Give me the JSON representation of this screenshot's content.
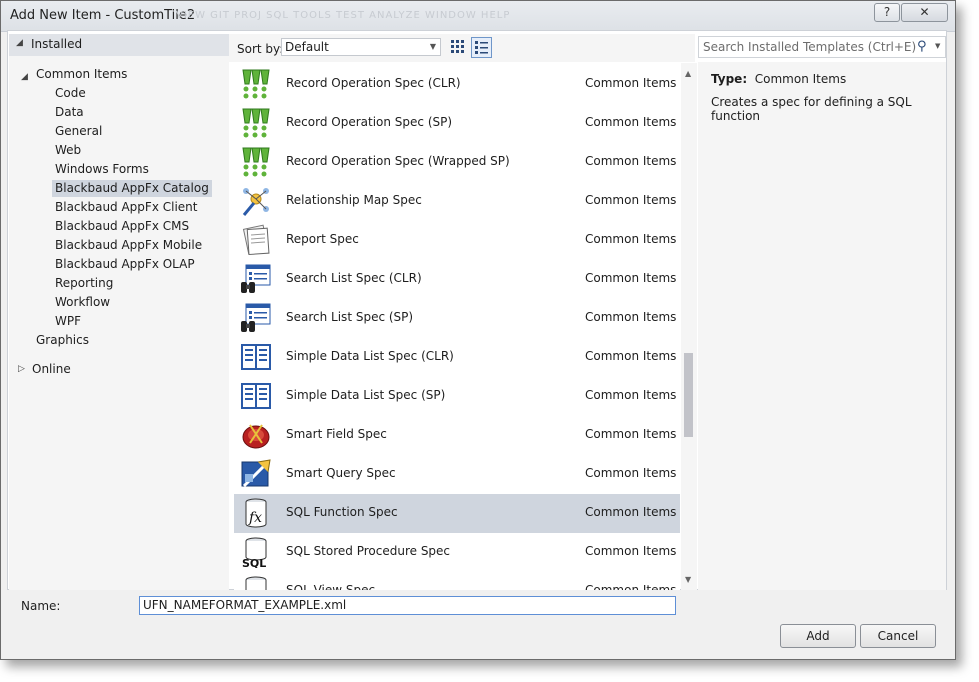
{
  "window": {
    "title": "Add New Item - CustomTile2",
    "ghost_menu": "VIEW   GIT   PROJ   SQL   TOOLS   TEST   ANALYZE   WINDOW   HELP",
    "help_label": "?",
    "close_label": "✕"
  },
  "tree": {
    "installed_label": "Installed",
    "common_items_label": "Common Items",
    "children": [
      "Code",
      "Data",
      "General",
      "Web",
      "Windows Forms",
      "Blackbaud AppFx Catalog",
      "Blackbaud AppFx Client",
      "Blackbaud AppFx CMS",
      "Blackbaud AppFx Mobile",
      "Blackbaud AppFx OLAP",
      "Reporting",
      "Workflow",
      "WPF"
    ],
    "selected_child": "Blackbaud AppFx Catalog",
    "graphics_label": "Graphics",
    "online_label": "Online"
  },
  "sort": {
    "label": "Sort by:",
    "value": "Default"
  },
  "search": {
    "placeholder": "Search Installed Templates (Ctrl+E)"
  },
  "templates": [
    {
      "name": "Record Operation Spec (CLR)",
      "category": "Common Items",
      "icon": "record-operation-icon"
    },
    {
      "name": "Record Operation Spec (SP)",
      "category": "Common Items",
      "icon": "record-operation-icon"
    },
    {
      "name": "Record Operation Spec (Wrapped SP)",
      "category": "Common Items",
      "icon": "record-operation-icon"
    },
    {
      "name": "Relationship Map Spec",
      "category": "Common Items",
      "icon": "relationship-map-icon"
    },
    {
      "name": "Report Spec",
      "category": "Common Items",
      "icon": "report-icon"
    },
    {
      "name": "Search List Spec (CLR)",
      "category": "Common Items",
      "icon": "search-list-icon"
    },
    {
      "name": "Search List Spec (SP)",
      "category": "Common Items",
      "icon": "search-list-icon"
    },
    {
      "name": "Simple Data List Spec (CLR)",
      "category": "Common Items",
      "icon": "simple-data-list-icon"
    },
    {
      "name": "Simple Data List Spec (SP)",
      "category": "Common Items",
      "icon": "simple-data-list-icon"
    },
    {
      "name": "Smart Field Spec",
      "category": "Common Items",
      "icon": "smart-field-icon"
    },
    {
      "name": "Smart Query Spec",
      "category": "Common Items",
      "icon": "smart-query-icon"
    },
    {
      "name": "SQL Function Spec",
      "category": "Common Items",
      "icon": "sql-function-icon"
    },
    {
      "name": "SQL Stored Procedure Spec",
      "category": "Common Items",
      "icon": "sql-stored-procedure-icon"
    },
    {
      "name": "SQL View Spec",
      "category": "Common Items",
      "icon": "sql-view-icon"
    }
  ],
  "selected_template": "SQL Function Spec",
  "details": {
    "type_label": "Type:",
    "type_value": "Common Items",
    "description": "Creates a spec for defining a SQL function"
  },
  "name_field": {
    "label": "Name:",
    "value": "UFN_NAMEFORMAT_EXAMPLE.xml"
  },
  "buttons": {
    "add": "Add",
    "cancel": "Cancel"
  },
  "colors": {
    "selection": "#cfd5de",
    "focus_border": "#5e8fd6",
    "panel_bg": "#f5f5f5"
  }
}
